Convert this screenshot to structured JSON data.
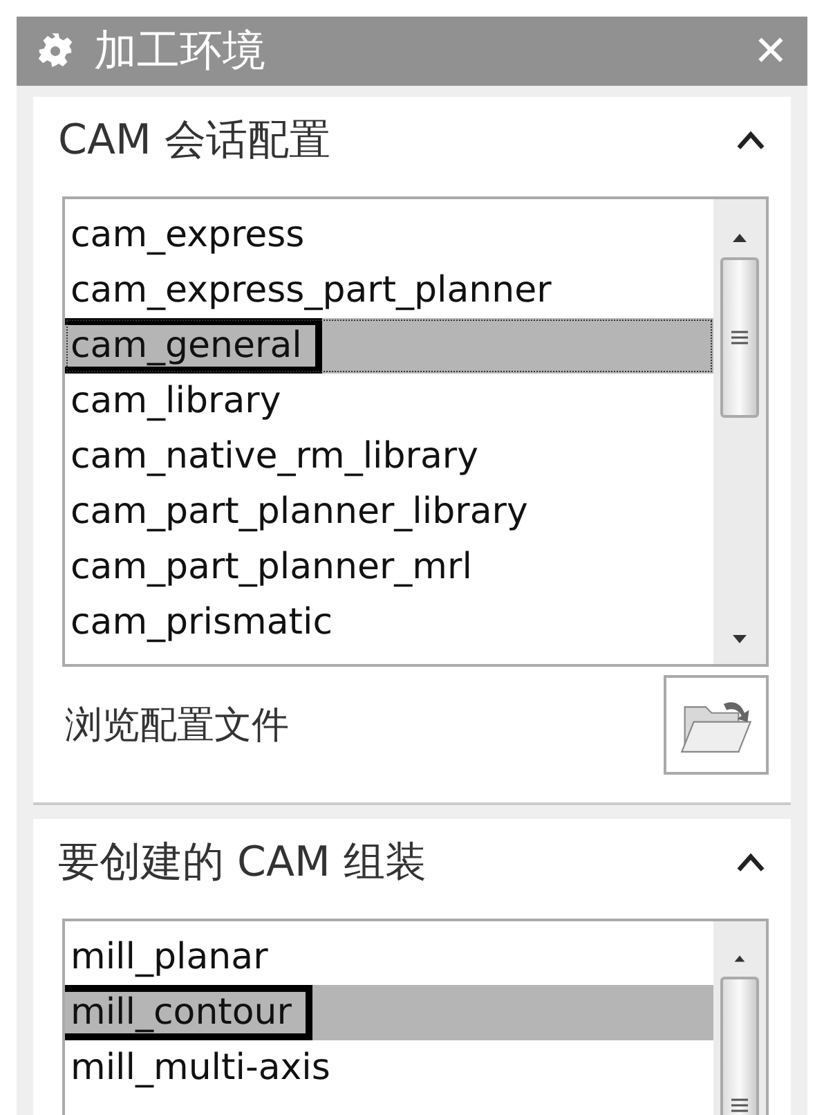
{
  "window": {
    "title": "加工环境",
    "close": "✕"
  },
  "sections": [
    {
      "title": "CAM 会话配置",
      "expanded": true,
      "list": {
        "items": [
          {
            "label": "cam_express",
            "selected": false,
            "framed": false
          },
          {
            "label": "cam_express_part_planner",
            "selected": false,
            "framed": false
          },
          {
            "label": "cam_general",
            "selected": true,
            "framed": true
          },
          {
            "label": "cam_library",
            "selected": false,
            "framed": false
          },
          {
            "label": "cam_native_rm_library",
            "selected": false,
            "framed": false
          },
          {
            "label": "cam_part_planner_library",
            "selected": false,
            "framed": false
          },
          {
            "label": "cam_part_planner_mrl",
            "selected": false,
            "framed": false
          },
          {
            "label": "cam_prismatic",
            "selected": false,
            "framed": false
          }
        ]
      },
      "browse": {
        "label": "浏览配置文件"
      }
    },
    {
      "title": "要创建的 CAM 组装",
      "expanded": true,
      "list": {
        "items": [
          {
            "label": "mill_planar",
            "selected": false,
            "framed": false
          },
          {
            "label": "mill_contour",
            "selected": true,
            "framed": true
          },
          {
            "label": "mill_multi-axis",
            "selected": false,
            "framed": false
          }
        ]
      }
    }
  ]
}
